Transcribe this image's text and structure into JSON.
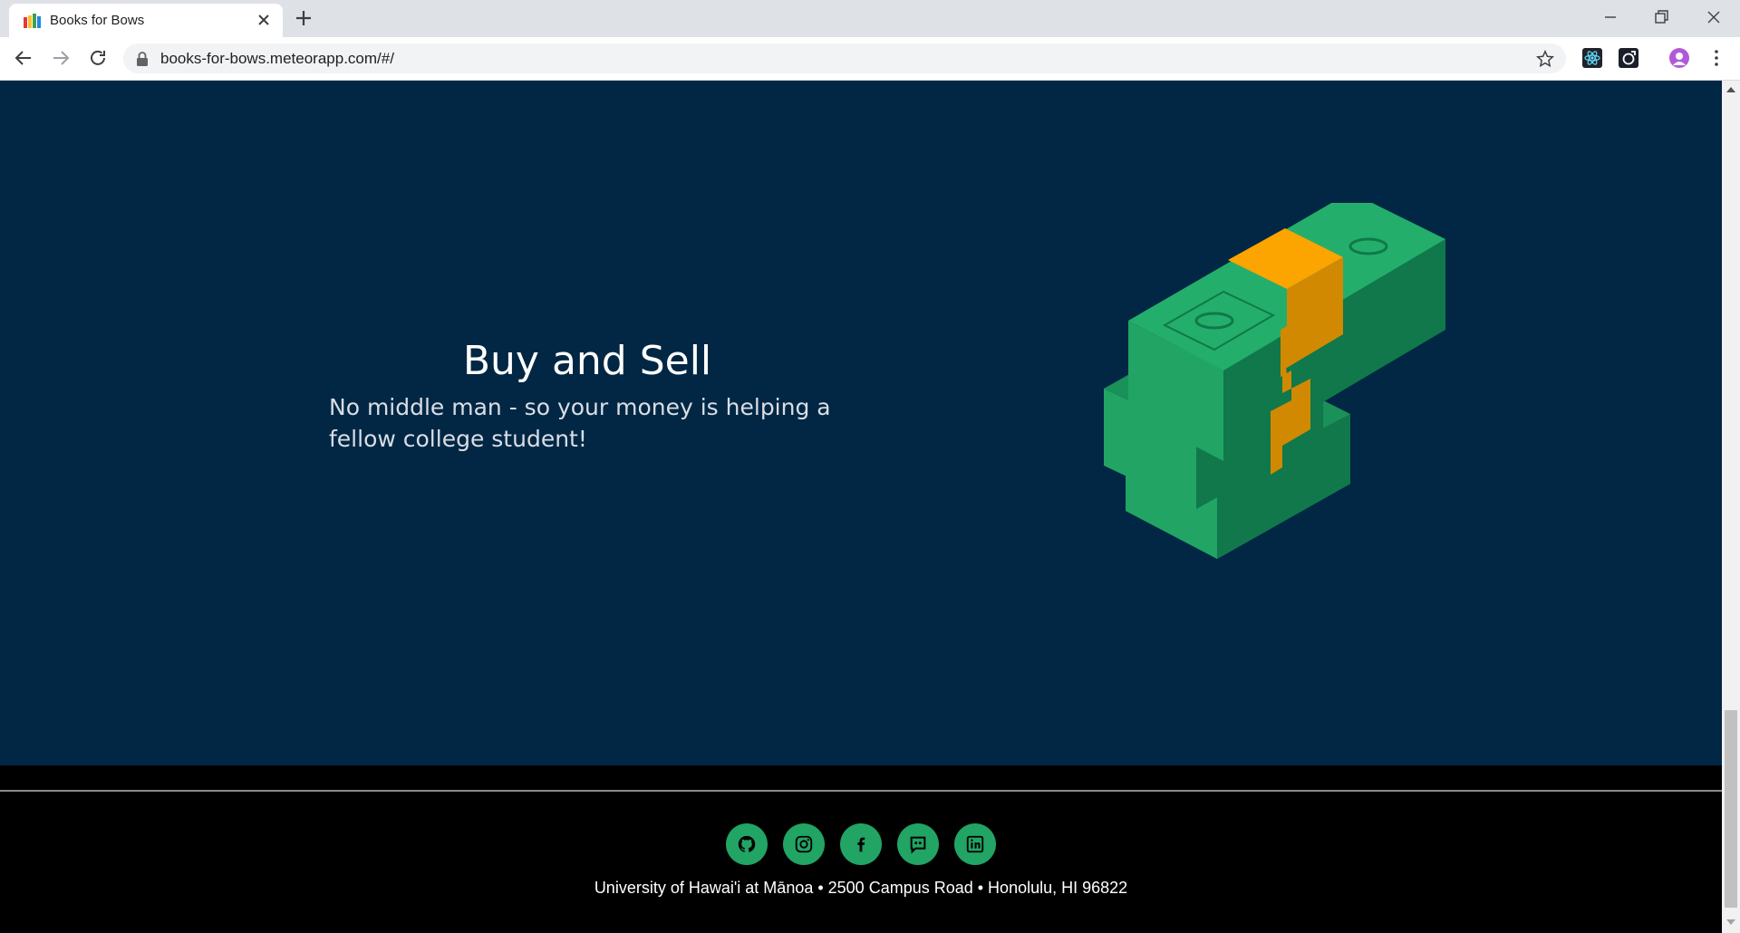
{
  "browser": {
    "tab_title": "Books for Bows",
    "url": "books-for-bows.meteorapp.com/#/"
  },
  "hero": {
    "title": "Buy and Sell",
    "text": "No middle man - so your money is helping a fellow college student!",
    "illustration": "money-stack-icon"
  },
  "footer": {
    "social_icons": [
      "github-icon",
      "instagram-icon",
      "facebook-icon",
      "discord-icon",
      "linkedin-icon"
    ],
    "address": "University of Hawai'i at Mānoa • 2500 Campus Road • Honolulu, HI 96822"
  },
  "colors": {
    "hero_bg": "#022744",
    "accent_green": "#21a464",
    "band_orange": "#fca400",
    "footer_bg": "#000000"
  }
}
